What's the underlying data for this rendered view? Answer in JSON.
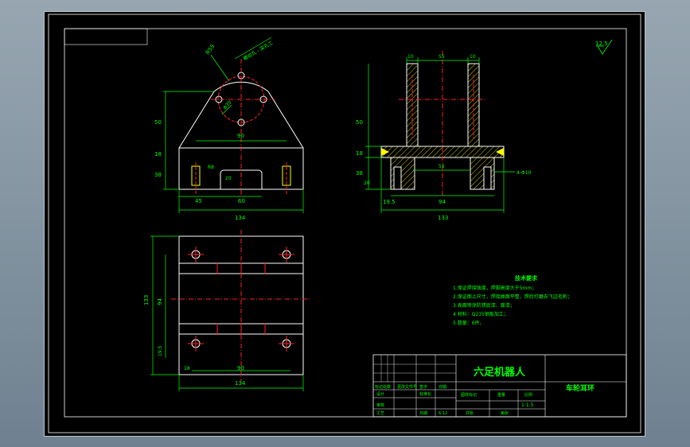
{
  "colors": {
    "background": "#000000",
    "outline": "#ffffff",
    "dimension": "#00ff00",
    "centerline": "#ff2020",
    "hatch": "#ffff00",
    "title_text": "#00ff00"
  },
  "front_view": {
    "dim_r55": "R55",
    "dim_hole_note": "螺纹孔 - 深孔工",
    "dim_phi30": "Φ30",
    "dim_50": "50",
    "dim_18": "18",
    "dim_38": "38",
    "dim_90": "90",
    "dim_r8": "R8",
    "dim_20": "20",
    "dim_45": "45",
    "dim_60": "60",
    "dim_134": "134"
  },
  "side_view": {
    "dim_10a": "10",
    "dim_55": "55",
    "dim_10b": "10",
    "dim_50": "50",
    "dim_18": "18",
    "dim_38": "38",
    "dim_20": "20",
    "dim_55b": "55",
    "dim_19_5": "19.5",
    "dim_94": "94",
    "dim_133": "133",
    "dim_holes": "4-Φ10"
  },
  "top_view": {
    "dim_133": "133",
    "dim_94": "94",
    "dim_19_5": "19.5",
    "dim_18": "18",
    "dim_90": "90",
    "dim_134": "134"
  },
  "roughness": "12.5",
  "tech_requirements": {
    "title": "技术要求",
    "lines": [
      "1.保证焊接强度，焊脚高度大于5mm；",
      "2.保证图上尺寸，焊接曲面平整，焊后打磨去飞边毛刺；",
      "3.表面喷涂防锈底漆、面漆；",
      "4.材料：Q235钢板加工；",
      "5.数量：6件。"
    ]
  },
  "title_block": {
    "project": "六足机器人",
    "part_name": "车轮耳环",
    "labels": [
      "标记处数",
      "更改文件号",
      "签字",
      "日期",
      "设计",
      "标准化",
      "图样标记",
      "重量",
      "比例",
      "审核",
      "工艺",
      "日期",
      "共张",
      "第张"
    ],
    "date": "6.12",
    "scale": "1:1.5"
  }
}
